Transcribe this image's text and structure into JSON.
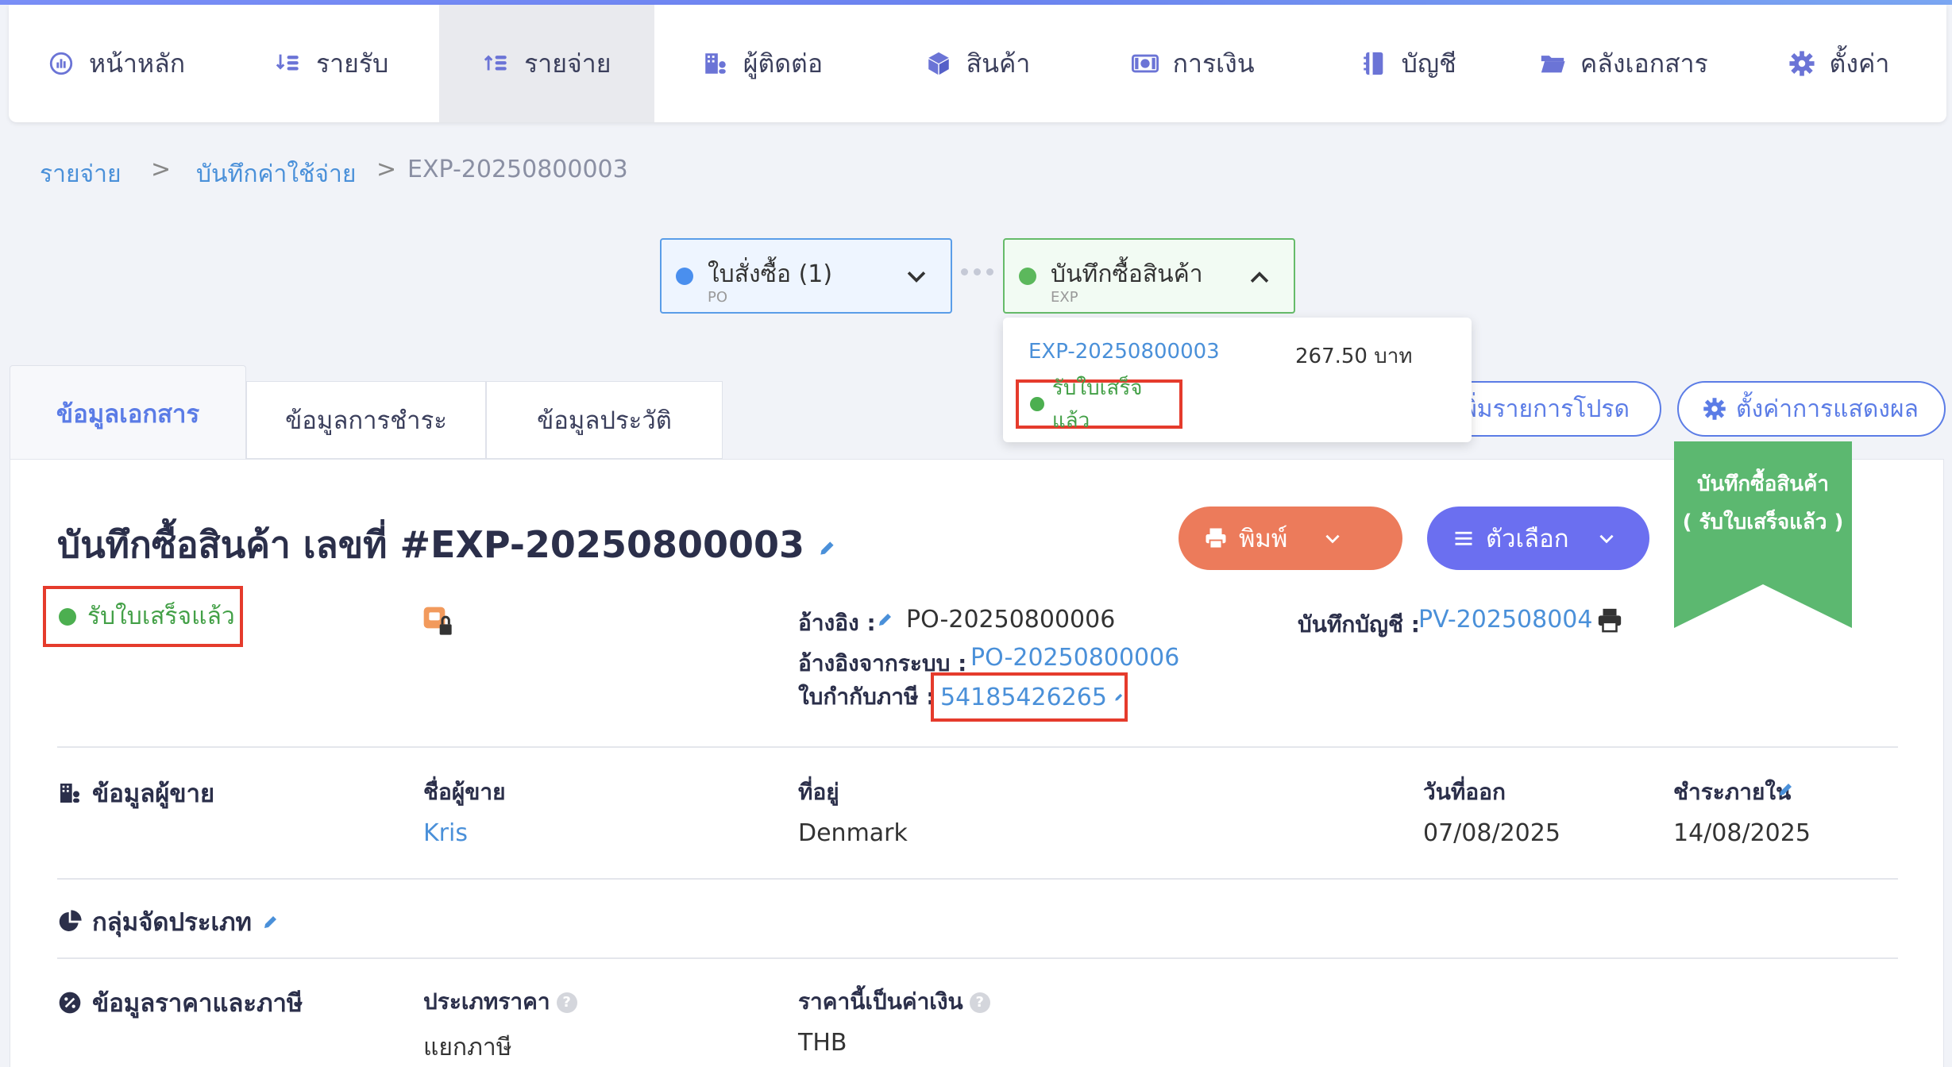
{
  "nav": {
    "items": [
      {
        "label": "หน้าหลัก",
        "icon": "dashboard-icon"
      },
      {
        "label": "รายรับ",
        "icon": "income-icon"
      },
      {
        "label": "รายจ่าย",
        "icon": "expense-icon"
      },
      {
        "label": "ผู้ติดต่อ",
        "icon": "contacts-icon"
      },
      {
        "label": "สินค้า",
        "icon": "product-box-icon"
      },
      {
        "label": "การเงิน",
        "icon": "money-icon"
      },
      {
        "label": "บัญชี",
        "icon": "ledger-book-icon"
      },
      {
        "label": "คลังเอกสาร",
        "icon": "folder-icon"
      },
      {
        "label": "ตั้งค่า",
        "icon": "gear-icon"
      }
    ],
    "active_index": 2
  },
  "breadcrumb": {
    "items": [
      "รายจ่าย",
      "บันทึกค่าใช้จ่าย",
      "EXP-20250800003"
    ],
    "separator": ">"
  },
  "flow": {
    "po": {
      "title": "ใบสั่งซื้อ (1)",
      "sub": "PO",
      "dot_color": "#4a8fee"
    },
    "exp": {
      "title": "บันทึกซื้อสินค้า",
      "sub": "EXP",
      "dot_color": "#5cb85c"
    },
    "dropdown": {
      "doc_no": "EXP-20250800003",
      "amount": "267.50 บาท",
      "status": "รับใบเสร็จแล้ว"
    }
  },
  "tabs": [
    "ข้อมูลเอกสาร",
    "ข้อมูลการชำระ",
    "ข้อมูลประวัติ"
  ],
  "actions": {
    "favorites": "พิ่มรายการโปรด",
    "display_settings": "ตั้งค่าการแสดงผล",
    "print": "พิมพ์",
    "options": "ตัวเลือก"
  },
  "ribbon": {
    "line1": "บันทึกซื้อสินค้า",
    "line2": "( รับใบเสร็จแล้ว )"
  },
  "document": {
    "title": "บันทึกซื้อสินค้า เลขที่ #EXP-20250800003",
    "status": "รับใบเสร็จแล้ว",
    "reference_label": "อ้างอิง :",
    "reference_value": "PO-20250800006",
    "system_ref_label": "อ้างอิงจากระบบ :",
    "system_ref_value": "PO-20250800006",
    "tax_invoice_label": "ใบกำกับภาษี :",
    "tax_invoice_value": "54185426265",
    "ledger_label": "บันทึกบัญชี :",
    "ledger_value": "PV-202508004"
  },
  "vendor": {
    "section": "ข้อมูลผู้ขาย",
    "name_label": "ชื่อผู้ขาย",
    "name_value": "Kris",
    "address_label": "ที่อยู่",
    "address_value": "Denmark",
    "issue_label": "วันที่ออก",
    "issue_value": "07/08/2025",
    "due_label": "ชำระภายใน",
    "due_value": "14/08/2025"
  },
  "category": {
    "section": "กลุ่มจัดประเภท"
  },
  "pricing": {
    "section": "ข้อมูลราคาและภาษี",
    "type_label": "ประเภทราคา",
    "type_value": "แยกภาษี",
    "currency_label": "ราคานี้เป็นค่าเงิน",
    "currency_value": "THB"
  },
  "colors": {
    "accent": "#5b7ce6",
    "link": "#4a90d9",
    "success": "#4caf50",
    "print_button": "#ec7b5b",
    "options_button": "#6b6ff0",
    "ribbon": "#5cb870",
    "highlight": "#e53b2c"
  }
}
